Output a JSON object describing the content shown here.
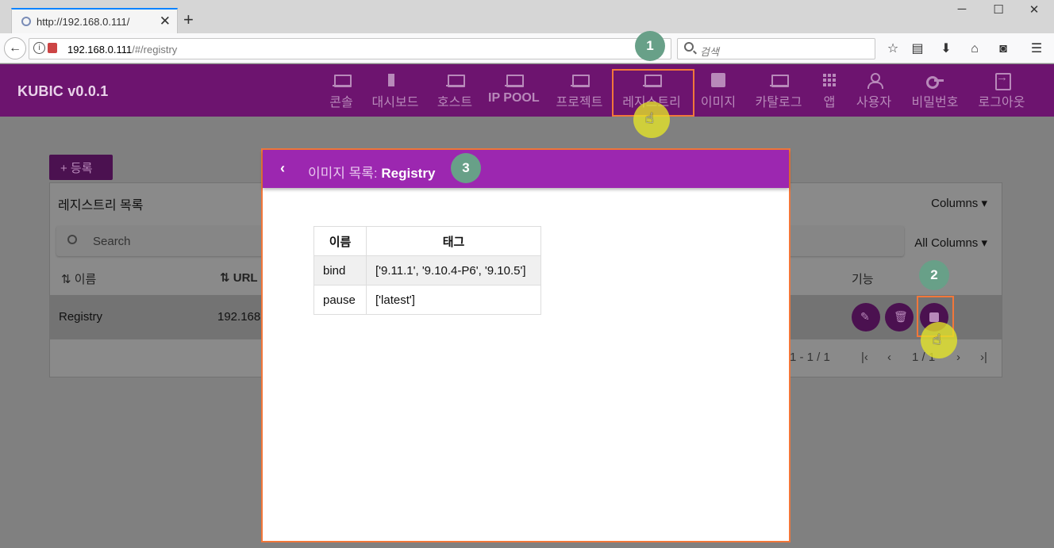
{
  "browser": {
    "tab_title": "http://192.168.0.111/",
    "new_tab": "+",
    "url_host": "192.168.0.111",
    "url_path": "/#/registry",
    "search_placeholder": "검색"
  },
  "app": {
    "brand": "KUBIC v0.0.1",
    "nav": [
      {
        "label": "콘솔",
        "icon": "laptop-icon"
      },
      {
        "label": "대시보드",
        "icon": "dashboard-icon"
      },
      {
        "label": "호스트",
        "icon": "laptop-icon"
      },
      {
        "label": "IP POOL",
        "icon": "laptop-icon"
      },
      {
        "label": "프로젝트",
        "icon": "laptop-icon"
      },
      {
        "label": "레지스트리",
        "icon": "laptop-icon",
        "active": true
      },
      {
        "label": "이미지",
        "icon": "image-icon"
      },
      {
        "label": "카탈로그",
        "icon": "laptop-icon"
      },
      {
        "label": "앱",
        "icon": "apps-icon"
      },
      {
        "label": "사용자",
        "icon": "user-icon"
      },
      {
        "label": "비밀번호",
        "icon": "key-icon"
      },
      {
        "label": "로그아웃",
        "icon": "logout-icon"
      }
    ],
    "accent_color": "#6d146f"
  },
  "page": {
    "register_button": "+ 등록",
    "card_title": "레지스트리 목록",
    "columns_dropdown": "Columns",
    "search_placeholder": "Search",
    "all_columns_dropdown": "All Columns",
    "headers": {
      "name": "⇅ 이름",
      "url": "⇅ URL",
      "actions": "기능"
    },
    "rows": [
      {
        "name": "Registry",
        "url": "192.168"
      }
    ],
    "pagination": {
      "range": "1 - 1 / 1",
      "page": "1 / 1"
    }
  },
  "annotations": [
    "1",
    "2",
    "3"
  ],
  "dialog": {
    "back": "‹",
    "title_prefix": "이미지 목록: ",
    "title_name": "Registry",
    "columns": [
      "이름",
      "태그"
    ],
    "rows": [
      {
        "name": "bind",
        "tags": "['9.11.1', '9.10.4-P6', '9.10.5']"
      },
      {
        "name": "pause",
        "tags": "['latest']"
      }
    ],
    "header_color": "#9c27b0"
  }
}
